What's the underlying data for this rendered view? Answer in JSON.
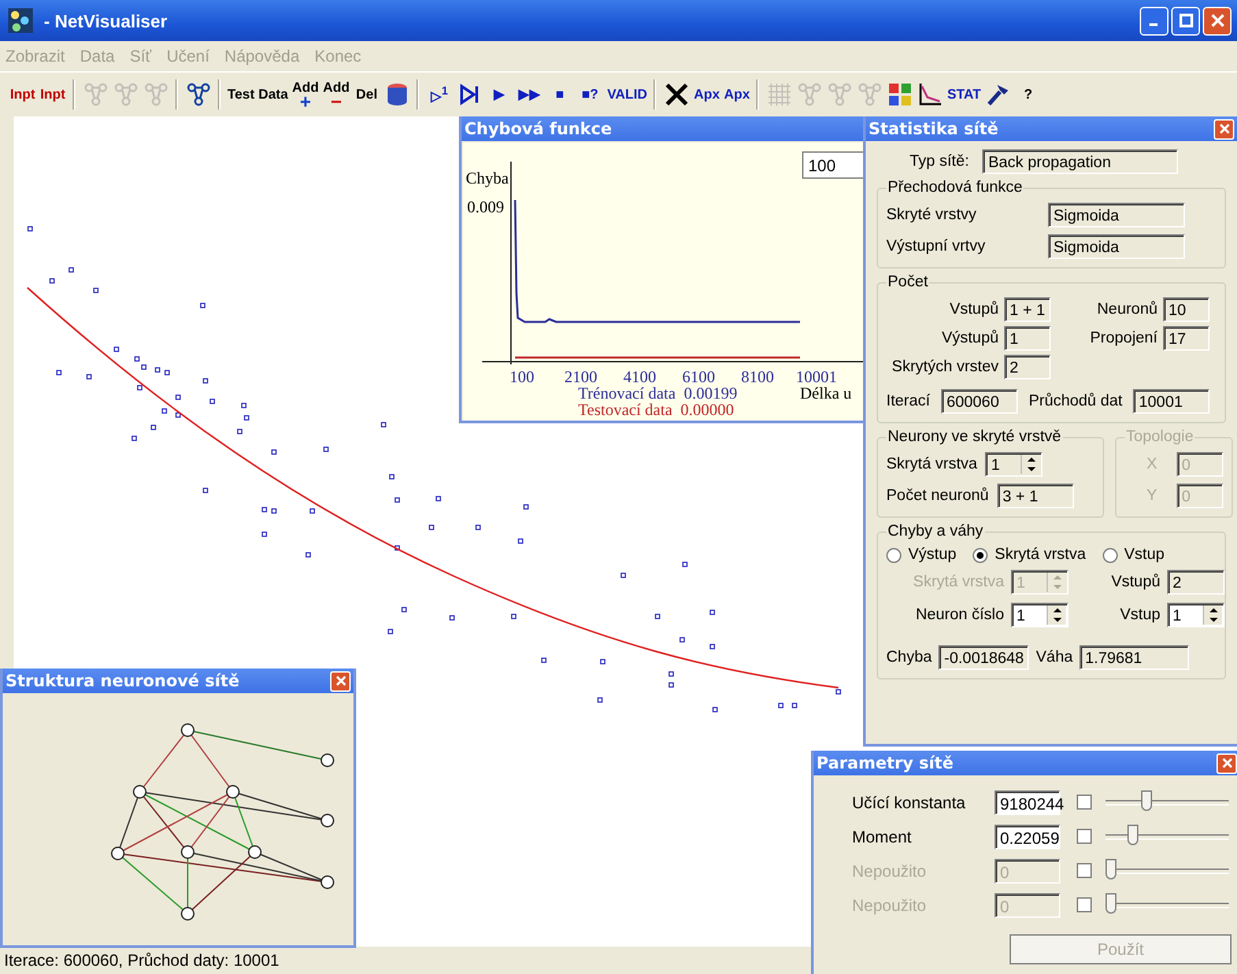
{
  "window": {
    "title": "- NetVisualiser"
  },
  "menu": [
    {
      "label": "Zobrazit",
      "disabled": true
    },
    {
      "label": "Data",
      "disabled": true
    },
    {
      "label": "Síť",
      "disabled": true
    },
    {
      "label": "Učení",
      "disabled": true
    },
    {
      "label": "Nápověda",
      "disabled": true
    },
    {
      "label": "Konec",
      "disabled": true
    }
  ],
  "toolbar": [
    {
      "kind": "label",
      "label": "Inpt",
      "color": "#c00000",
      "disabled": false
    },
    {
      "kind": "label",
      "label": "Inpt",
      "color": "#c00000",
      "disabled": false
    },
    {
      "kind": "separator"
    },
    {
      "kind": "icon",
      "disabled": true
    },
    {
      "kind": "icon",
      "disabled": true
    },
    {
      "kind": "icon",
      "disabled": true
    },
    {
      "kind": "separator"
    },
    {
      "kind": "icon",
      "disabled": false
    },
    {
      "kind": "separator"
    },
    {
      "kind": "label",
      "label": "Test Data",
      "color": "#000000",
      "disabled": false
    },
    {
      "kind": "label",
      "label": "Add",
      "mark": {
        "text": "+",
        "color": "#1040d0"
      },
      "color": "#000000",
      "disabled": false
    },
    {
      "kind": "label",
      "label": "Add",
      "mark": {
        "text": "−",
        "color": "#d01010"
      },
      "color": "#000000",
      "disabled": false
    },
    {
      "kind": "label",
      "label": "Del",
      "color": "#000000",
      "disabled": false
    },
    {
      "kind": "icon",
      "disabled": false
    },
    {
      "kind": "separator"
    },
    {
      "kind": "label",
      "label": "▷$^{1}$",
      "color": "#1020c0",
      "disabled": false
    },
    {
      "kind": "icon",
      "disabled": false
    },
    {
      "kind": "label",
      "label": "▶",
      "color": "#1020c0",
      "disabled": false
    },
    {
      "kind": "label",
      "label": "▶▶",
      "color": "#1020c0",
      "disabled": false
    },
    {
      "kind": "label",
      "label": "■",
      "color": "#1020c0",
      "disabled": false
    },
    {
      "kind": "label",
      "label": "■?",
      "color": "#1020c0",
      "disabled": false
    },
    {
      "kind": "label",
      "label": "VALID",
      "color": "#1020c0",
      "disabled": false
    },
    {
      "kind": "separator"
    },
    {
      "kind": "icon",
      "disabled": false
    },
    {
      "kind": "label",
      "label": "Apx",
      "color": "#1020c0",
      "disabled": false
    },
    {
      "kind": "label",
      "label": "Apx",
      "color": "#1020c0",
      "disabled": false
    },
    {
      "kind": "separator"
    },
    {
      "kind": "icon",
      "disabled": true
    },
    {
      "kind": "icon",
      "disabled": true
    },
    {
      "kind": "icon",
      "disabled": true
    },
    {
      "kind": "icon",
      "disabled": true
    },
    {
      "kind": "icon",
      "disabled": false
    },
    {
      "kind": "icon",
      "disabled": false
    },
    {
      "kind": "label",
      "label": "STAT",
      "color": "#1020c0",
      "disabled": false
    },
    {
      "kind": "icon",
      "disabled": false
    },
    {
      "kind": "label",
      "label": "?",
      "color": "#000000",
      "disabled": false
    }
  ],
  "error_window": {
    "title": "Chybová funkce",
    "y_label": "Chyba",
    "y_tick": "0.009",
    "interval": "100",
    "x_ticks": [
      "100",
      "2100",
      "4100",
      "6100",
      "8100",
      "10001"
    ],
    "x_label": "Délka u",
    "legend": [
      {
        "label": "Trénovací data",
        "value": "0.00199",
        "color": "#2d2d9a"
      },
      {
        "label": "Testovací data",
        "value": "0.00000",
        "color": "#c02828"
      }
    ]
  },
  "stats_window": {
    "title": "Statistika sítě",
    "type": {
      "label": "Typ sítě:",
      "value": "Back propagation"
    },
    "transfer": {
      "title": "Přechodová funkce",
      "rows": [
        {
          "label": "Skryté vrstvy",
          "value": "Sigmoida"
        },
        {
          "label": "Výstupní vrtvy",
          "value": "Sigmoida"
        }
      ]
    },
    "counts": {
      "title": "Počet",
      "fields": [
        {
          "label": "Vstupů",
          "value": "1 + 1"
        },
        {
          "label": "Neuronů",
          "value": "10"
        },
        {
          "label": "Výstupů",
          "value": "1"
        },
        {
          "label": "Propojení",
          "value": "17"
        },
        {
          "label": "Skrytých vrstev",
          "value": "2"
        },
        {
          "label": "Iterací",
          "value": "600060"
        },
        {
          "label": "Průchodů dat",
          "value": "10001"
        }
      ]
    },
    "hidden": {
      "title": "Neurony ve skryté vrstvě",
      "layer": {
        "label": "Skrytá vrstva",
        "value": "1"
      },
      "count": {
        "label": "Počet neuronů",
        "value": "3 + 1"
      }
    },
    "topology": {
      "title": "Topologie",
      "disabled": true,
      "fields": [
        {
          "label": "X",
          "value": "0"
        },
        {
          "label": "Y",
          "value": "0"
        }
      ]
    },
    "errors": {
      "title": "Chyby a váhy",
      "radios": [
        {
          "label": "Výstup",
          "selected": false
        },
        {
          "label": "Skrytá vrstva",
          "selected": true
        },
        {
          "label": "Vstup",
          "selected": false
        }
      ],
      "layer": {
        "label": "Skrytá vrstva",
        "value": "1",
        "disabled": true
      },
      "inputs": {
        "label": "Vstupů",
        "value": "2"
      },
      "neuron": {
        "label": "Neuron číslo",
        "value": "1"
      },
      "input": {
        "label": "Vstup",
        "value": "1"
      },
      "error": {
        "label": "Chyba",
        "value": "-0.0018648"
      },
      "weight": {
        "label": "Váha",
        "value": "1.79681"
      }
    }
  },
  "structure_window": {
    "title": "Struktura neuronové sítě"
  },
  "params_window": {
    "title": "Parametry sítě",
    "rows": [
      {
        "label": "Učící konstanta",
        "value": "9180244",
        "checked": false,
        "level": 0.33,
        "disabled": false
      },
      {
        "label": "Moment",
        "value": "0.22059",
        "checked": false,
        "level": 0.2,
        "disabled": false
      },
      {
        "label": "Nepoužito",
        "value": "0",
        "checked": false,
        "level": 0,
        "disabled": true
      },
      {
        "label": "Nepoužito",
        "value": "0",
        "checked": false,
        "level": 0,
        "disabled": true
      }
    ],
    "apply": {
      "label": "Použít",
      "disabled": true
    }
  },
  "status_bar": "Iterace: 600060, Průchod daty: 10001"
}
